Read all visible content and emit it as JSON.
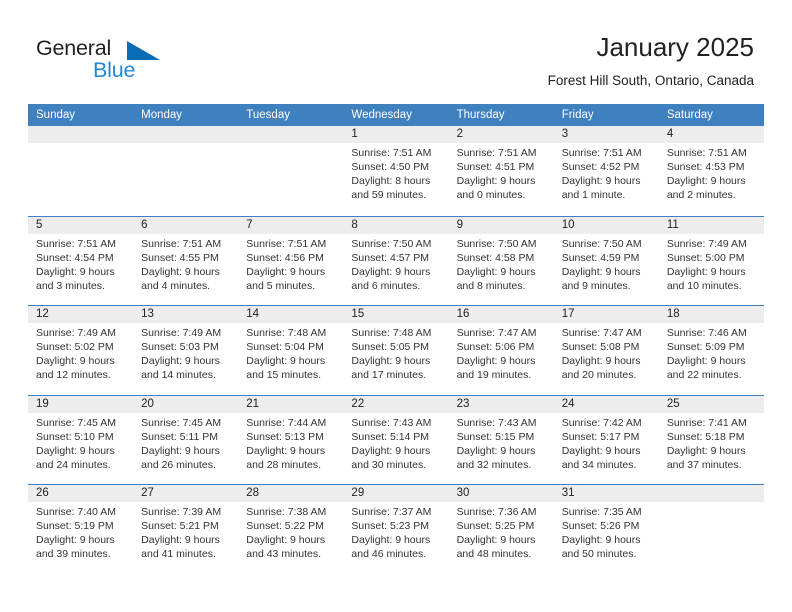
{
  "logo": {
    "word_one": "General",
    "word_two": "Blue",
    "triangle_color": "#0a6cb5",
    "blue_color": "#2189d6"
  },
  "header": {
    "title": "January 2025",
    "subtitle": "Forest Hill South, Ontario, Canada"
  },
  "theme": {
    "header_blue": "#3f80bf",
    "day_band_gray": "#ededed",
    "text": "#222222"
  },
  "weekdays": [
    "Sunday",
    "Monday",
    "Tuesday",
    "Wednesday",
    "Thursday",
    "Friday",
    "Saturday"
  ],
  "weeks": [
    [
      {
        "day": "",
        "sunrise": "",
        "sunset": "",
        "daylight": ""
      },
      {
        "day": "",
        "sunrise": "",
        "sunset": "",
        "daylight": ""
      },
      {
        "day": "",
        "sunrise": "",
        "sunset": "",
        "daylight": ""
      },
      {
        "day": "1",
        "sunrise": "Sunrise: 7:51 AM",
        "sunset": "Sunset: 4:50 PM",
        "daylight": "Daylight: 8 hours and 59 minutes."
      },
      {
        "day": "2",
        "sunrise": "Sunrise: 7:51 AM",
        "sunset": "Sunset: 4:51 PM",
        "daylight": "Daylight: 9 hours and 0 minutes."
      },
      {
        "day": "3",
        "sunrise": "Sunrise: 7:51 AM",
        "sunset": "Sunset: 4:52 PM",
        "daylight": "Daylight: 9 hours and 1 minute."
      },
      {
        "day": "4",
        "sunrise": "Sunrise: 7:51 AM",
        "sunset": "Sunset: 4:53 PM",
        "daylight": "Daylight: 9 hours and 2 minutes."
      }
    ],
    [
      {
        "day": "5",
        "sunrise": "Sunrise: 7:51 AM",
        "sunset": "Sunset: 4:54 PM",
        "daylight": "Daylight: 9 hours and 3 minutes."
      },
      {
        "day": "6",
        "sunrise": "Sunrise: 7:51 AM",
        "sunset": "Sunset: 4:55 PM",
        "daylight": "Daylight: 9 hours and 4 minutes."
      },
      {
        "day": "7",
        "sunrise": "Sunrise: 7:51 AM",
        "sunset": "Sunset: 4:56 PM",
        "daylight": "Daylight: 9 hours and 5 minutes."
      },
      {
        "day": "8",
        "sunrise": "Sunrise: 7:50 AM",
        "sunset": "Sunset: 4:57 PM",
        "daylight": "Daylight: 9 hours and 6 minutes."
      },
      {
        "day": "9",
        "sunrise": "Sunrise: 7:50 AM",
        "sunset": "Sunset: 4:58 PM",
        "daylight": "Daylight: 9 hours and 8 minutes."
      },
      {
        "day": "10",
        "sunrise": "Sunrise: 7:50 AM",
        "sunset": "Sunset: 4:59 PM",
        "daylight": "Daylight: 9 hours and 9 minutes."
      },
      {
        "day": "11",
        "sunrise": "Sunrise: 7:49 AM",
        "sunset": "Sunset: 5:00 PM",
        "daylight": "Daylight: 9 hours and 10 minutes."
      }
    ],
    [
      {
        "day": "12",
        "sunrise": "Sunrise: 7:49 AM",
        "sunset": "Sunset: 5:02 PM",
        "daylight": "Daylight: 9 hours and 12 minutes."
      },
      {
        "day": "13",
        "sunrise": "Sunrise: 7:49 AM",
        "sunset": "Sunset: 5:03 PM",
        "daylight": "Daylight: 9 hours and 14 minutes."
      },
      {
        "day": "14",
        "sunrise": "Sunrise: 7:48 AM",
        "sunset": "Sunset: 5:04 PM",
        "daylight": "Daylight: 9 hours and 15 minutes."
      },
      {
        "day": "15",
        "sunrise": "Sunrise: 7:48 AM",
        "sunset": "Sunset: 5:05 PM",
        "daylight": "Daylight: 9 hours and 17 minutes."
      },
      {
        "day": "16",
        "sunrise": "Sunrise: 7:47 AM",
        "sunset": "Sunset: 5:06 PM",
        "daylight": "Daylight: 9 hours and 19 minutes."
      },
      {
        "day": "17",
        "sunrise": "Sunrise: 7:47 AM",
        "sunset": "Sunset: 5:08 PM",
        "daylight": "Daylight: 9 hours and 20 minutes."
      },
      {
        "day": "18",
        "sunrise": "Sunrise: 7:46 AM",
        "sunset": "Sunset: 5:09 PM",
        "daylight": "Daylight: 9 hours and 22 minutes."
      }
    ],
    [
      {
        "day": "19",
        "sunrise": "Sunrise: 7:45 AM",
        "sunset": "Sunset: 5:10 PM",
        "daylight": "Daylight: 9 hours and 24 minutes."
      },
      {
        "day": "20",
        "sunrise": "Sunrise: 7:45 AM",
        "sunset": "Sunset: 5:11 PM",
        "daylight": "Daylight: 9 hours and 26 minutes."
      },
      {
        "day": "21",
        "sunrise": "Sunrise: 7:44 AM",
        "sunset": "Sunset: 5:13 PM",
        "daylight": "Daylight: 9 hours and 28 minutes."
      },
      {
        "day": "22",
        "sunrise": "Sunrise: 7:43 AM",
        "sunset": "Sunset: 5:14 PM",
        "daylight": "Daylight: 9 hours and 30 minutes."
      },
      {
        "day": "23",
        "sunrise": "Sunrise: 7:43 AM",
        "sunset": "Sunset: 5:15 PM",
        "daylight": "Daylight: 9 hours and 32 minutes."
      },
      {
        "day": "24",
        "sunrise": "Sunrise: 7:42 AM",
        "sunset": "Sunset: 5:17 PM",
        "daylight": "Daylight: 9 hours and 34 minutes."
      },
      {
        "day": "25",
        "sunrise": "Sunrise: 7:41 AM",
        "sunset": "Sunset: 5:18 PM",
        "daylight": "Daylight: 9 hours and 37 minutes."
      }
    ],
    [
      {
        "day": "26",
        "sunrise": "Sunrise: 7:40 AM",
        "sunset": "Sunset: 5:19 PM",
        "daylight": "Daylight: 9 hours and 39 minutes."
      },
      {
        "day": "27",
        "sunrise": "Sunrise: 7:39 AM",
        "sunset": "Sunset: 5:21 PM",
        "daylight": "Daylight: 9 hours and 41 minutes."
      },
      {
        "day": "28",
        "sunrise": "Sunrise: 7:38 AM",
        "sunset": "Sunset: 5:22 PM",
        "daylight": "Daylight: 9 hours and 43 minutes."
      },
      {
        "day": "29",
        "sunrise": "Sunrise: 7:37 AM",
        "sunset": "Sunset: 5:23 PM",
        "daylight": "Daylight: 9 hours and 46 minutes."
      },
      {
        "day": "30",
        "sunrise": "Sunrise: 7:36 AM",
        "sunset": "Sunset: 5:25 PM",
        "daylight": "Daylight: 9 hours and 48 minutes."
      },
      {
        "day": "31",
        "sunrise": "Sunrise: 7:35 AM",
        "sunset": "Sunset: 5:26 PM",
        "daylight": "Daylight: 9 hours and 50 minutes."
      },
      {
        "day": "",
        "sunrise": "",
        "sunset": "",
        "daylight": ""
      }
    ]
  ]
}
